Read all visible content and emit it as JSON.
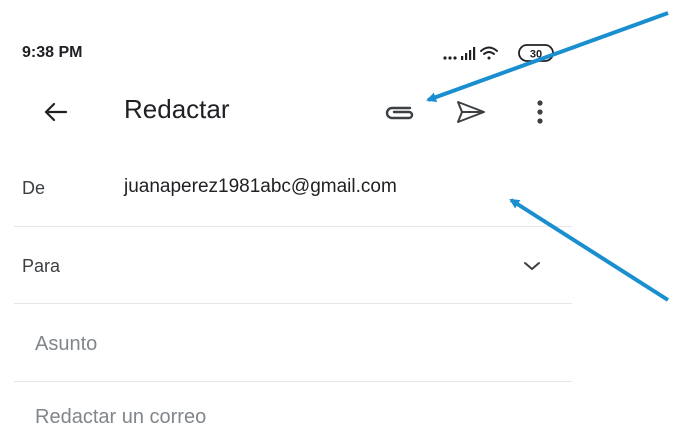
{
  "status_bar": {
    "time": "9:38 PM",
    "battery": "30"
  },
  "app_bar": {
    "back_icon": "arrow-left-icon",
    "title": "Redactar",
    "attach_icon": "paperclip-icon",
    "send_icon": "send-icon",
    "more_icon": "more-vert-icon"
  },
  "compose": {
    "from_label": "De",
    "from_value": "juanaperez1981abc@gmail.com",
    "to_label": "Para",
    "subject_placeholder": "Asunto",
    "body_placeholder": "Redactar un correo"
  },
  "annotation": {
    "arrow_color": "#1a8fd0"
  }
}
